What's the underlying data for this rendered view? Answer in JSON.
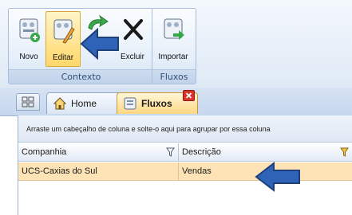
{
  "ribbon": {
    "groups": [
      {
        "label": "Contexto"
      },
      {
        "label": "Fluxos"
      }
    ],
    "buttons": {
      "novo": "Novo",
      "editar": "Editar",
      "excluir": "Excluir",
      "importar": "Importar"
    }
  },
  "tabs": [
    {
      "label": "Home",
      "icon": "home-icon"
    },
    {
      "label": "Fluxos",
      "icon": "flow-icon"
    }
  ],
  "grid": {
    "group_hint": "Arraste um cabeçalho de coluna e solte-o aqui para agrupar por essa coluna",
    "columns": [
      "Companhia",
      "Descrição"
    ],
    "rows": [
      {
        "companhia": "UCS-Caxias do Sul",
        "descricao": "Vendas"
      }
    ]
  },
  "colors": {
    "accent": "#ffd86a",
    "selected_row": "#fde3b5",
    "arrow": "#2f63b7",
    "close": "#d9332b"
  }
}
